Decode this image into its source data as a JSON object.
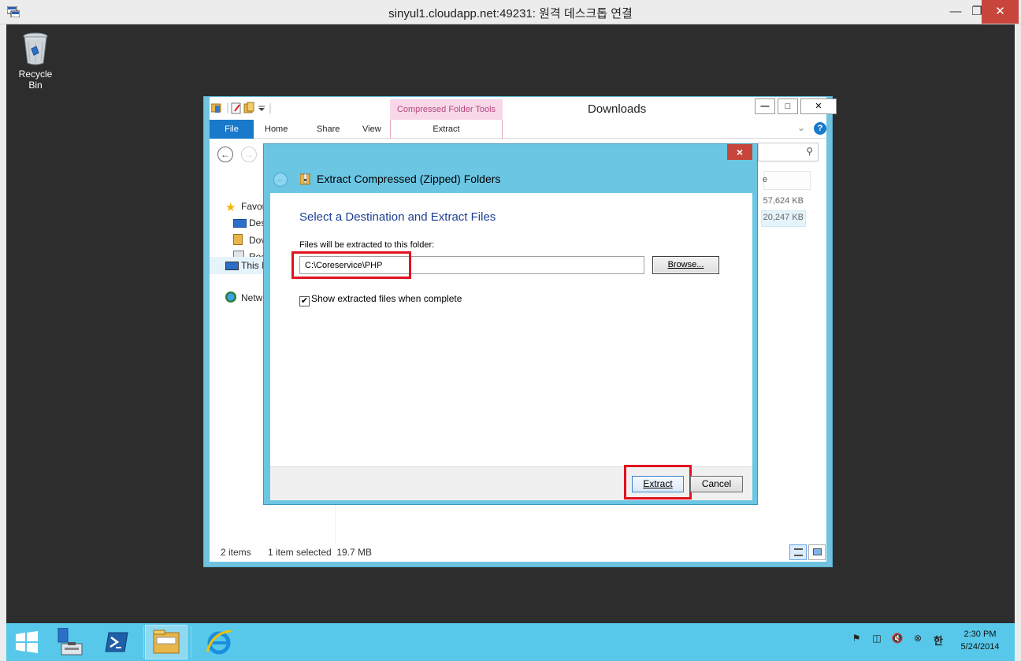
{
  "rdp": {
    "title": "sinyul1.cloudapp.net:49231: 원격 데스크톱 연결",
    "minimize_icon": "minimize-icon",
    "maximize_icon": "maximize-icon",
    "close_icon": "close-icon"
  },
  "desktop": {
    "recycle_bin_label": "Recycle Bin"
  },
  "explorer": {
    "title": "Downloads",
    "contextual_tab_group": "Compressed Folder Tools",
    "ribbon_tabs": [
      "File",
      "Home",
      "Share",
      "View",
      "Extract"
    ],
    "nav_items": {
      "favorites": "Favor",
      "desktop": "Des",
      "downloads": "Dov",
      "recent": "Rec",
      "this_pc": "This I",
      "network": "Netw"
    },
    "name_column_partial": "e",
    "sizes": [
      "57,624 KB",
      "20,247 KB"
    ],
    "status_items": "2 items",
    "status_selected": "1 item selected  19.7 MB"
  },
  "dialog": {
    "title": "Extract Compressed (Zipped) Folders",
    "heading": "Select a Destination and Extract Files",
    "path_label": "Files will be extracted to this folder:",
    "path_value": "C:\\Coreservice\\PHP",
    "browse_label": "Browse...",
    "checkbox_label": "Show extracted files when complete",
    "checkbox_checked": true,
    "extract_label": "Extract",
    "cancel_label": "Cancel",
    "highlight_color": "#e0121f"
  },
  "taskbar": {
    "clock_time": "2:30 PM",
    "clock_date": "5/24/2014",
    "ime_label": "한",
    "color": "#57c8ea"
  }
}
